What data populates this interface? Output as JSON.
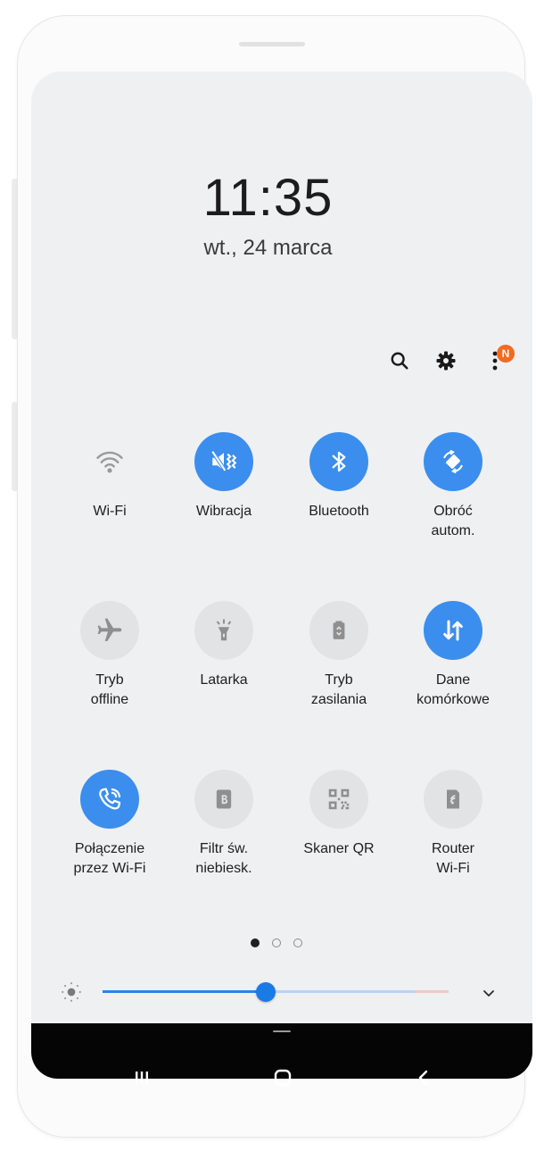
{
  "status": {
    "time": "11:35",
    "date": "wt., 24 marca"
  },
  "toolbar": {
    "notification_badge": "N"
  },
  "tiles": [
    {
      "label": "Wi-Fi",
      "icon": "wifi-icon",
      "active": false
    },
    {
      "label": "Wibracja",
      "icon": "vibrate-icon",
      "active": true
    },
    {
      "label": "Bluetooth",
      "icon": "bluetooth-icon",
      "active": true
    },
    {
      "label": "Obróć\nautom.",
      "icon": "auto-rotate-icon",
      "active": true
    },
    {
      "label": "Tryb\noffline",
      "icon": "airplane-icon",
      "active": false
    },
    {
      "label": "Latarka",
      "icon": "flashlight-icon",
      "active": false
    },
    {
      "label": "Tryb\nzasilania",
      "icon": "battery-icon",
      "active": false
    },
    {
      "label": "Dane\nkomórkowe",
      "icon": "mobile-data-icon",
      "active": true
    },
    {
      "label": "Połączenie\nprzez Wi-Fi",
      "icon": "wifi-calling-icon",
      "active": true
    },
    {
      "label": "Filtr św.\nniebiesk.",
      "icon": "blue-light-filter-icon",
      "active": false
    },
    {
      "label": "Skaner QR",
      "icon": "qr-scanner-icon",
      "active": false
    },
    {
      "label": "Router\nWi-Fi",
      "icon": "mobile-hotspot-icon",
      "active": false
    }
  ],
  "pager": {
    "pages": 3,
    "current": 1
  },
  "brightness": {
    "level_fraction": 0.47
  },
  "colors": {
    "accent": "#3b8eed",
    "badge": "#f26b21",
    "inactive_tile": "#e2e3e5"
  }
}
